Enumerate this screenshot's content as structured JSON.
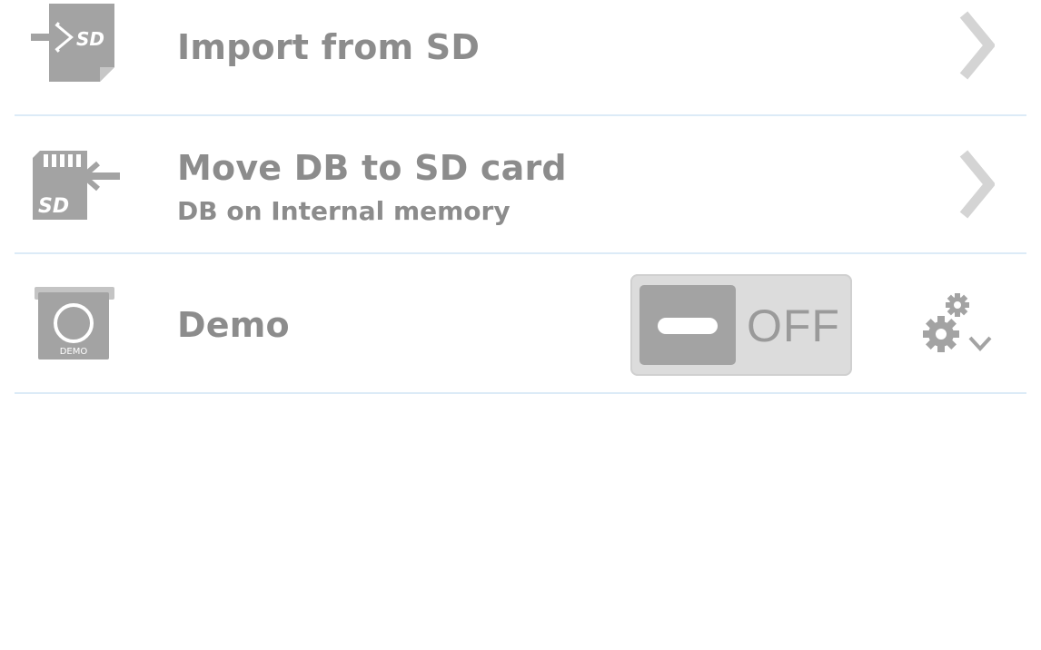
{
  "settings_list": {
    "items": [
      {
        "icon": "import-from-sd-icon",
        "label": "Import from SD",
        "action_icon": "chevron-right-icon"
      },
      {
        "icon": "move-to-sd-icon",
        "label": "Move DB to SD card",
        "sublabel": "DB on Internal memory",
        "action_icon": "chevron-right-icon"
      },
      {
        "icon": "demo-db-icon",
        "label": "Demo",
        "toggle": {
          "state_text": "OFF",
          "is_on": false
        },
        "action_icon": "settings-gear-icon"
      }
    ]
  },
  "colors": {
    "text": "#8c8c8c",
    "icon": "#a3a3a3",
    "divider": "#dcebf7",
    "chevron": "#d4d4d4",
    "toggle_track": "#dcdcdc",
    "toggle_thumb": "#a3a3a3"
  }
}
